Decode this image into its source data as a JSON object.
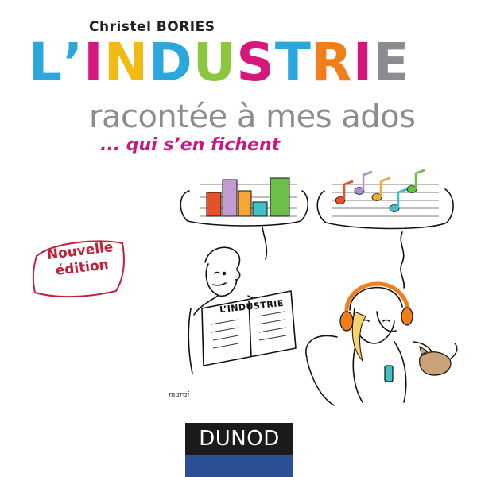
{
  "cover": {
    "author": "Christel BORIES",
    "title_letters": [
      {
        "char": "L",
        "color": "#2aa8dc"
      },
      {
        "char": "’",
        "color": "#2aa8dc"
      },
      {
        "char": "I",
        "color": "#d6177c"
      },
      {
        "char": "N",
        "color": "#f2bb12"
      },
      {
        "char": "D",
        "color": "#2aa8dc"
      },
      {
        "char": "U",
        "color": "#8cc63f"
      },
      {
        "char": "S",
        "color": "#d6177c"
      },
      {
        "char": "T",
        "color": "#2aa8dc"
      },
      {
        "char": "R",
        "color": "#f07e1b"
      },
      {
        "char": "I",
        "color": "#d6177c"
      },
      {
        "char": "E",
        "color": "#8a8c8f"
      }
    ],
    "subtitle": "racontée à mes ados",
    "tagline": "... qui s’en fichent",
    "badge_line1": "Nouvelle",
    "badge_line2": "édition",
    "newspaper_title": "L’INDUSTRIE",
    "illustrator_signature": "marai",
    "publisher": "DUNOD"
  },
  "colors": {
    "blue": "#2aa8dc",
    "magenta": "#d6177c",
    "yellow": "#f2bb12",
    "green": "#8cc63f",
    "orange": "#f07e1b",
    "grey": "#8a8c8f",
    "badge_red": "#c21f3a",
    "publisher_blue": "#2d4f96"
  },
  "chart_bubble": {
    "bars": [
      {
        "color": "#e8502a"
      },
      {
        "color": "#c39bd3"
      },
      {
        "color": "#f7a634"
      },
      {
        "color": "#3fc1c9"
      },
      {
        "color": "#6cc04a"
      }
    ]
  },
  "music_bubble": {
    "note_colors": [
      "#e8502a",
      "#b38bd0",
      "#f7a634",
      "#3fc1c9",
      "#6cc04a"
    ]
  }
}
